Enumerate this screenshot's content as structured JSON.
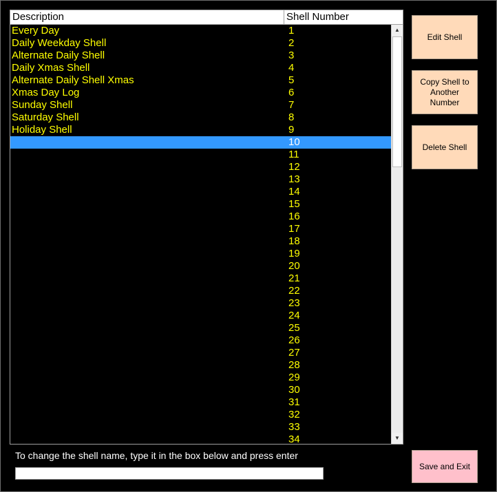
{
  "grid": {
    "columns": {
      "description": "Description",
      "shell_number": "Shell Number"
    },
    "selected_index": 9,
    "rows": [
      {
        "description": "Every Day",
        "number": "1"
      },
      {
        "description": "Daily Weekday Shell",
        "number": "2"
      },
      {
        "description": "Alternate Daily Shell",
        "number": "3"
      },
      {
        "description": "Daily  Xmas Shell",
        "number": "4"
      },
      {
        "description": "Alternate Daily Shell Xmas",
        "number": "5"
      },
      {
        "description": "Xmas Day Log",
        "number": "6"
      },
      {
        "description": "Sunday Shell",
        "number": "7"
      },
      {
        "description": "Saturday Shell",
        "number": "8"
      },
      {
        "description": "Holiday Shell",
        "number": "9"
      },
      {
        "description": "",
        "number": "10"
      },
      {
        "description": "",
        "number": "11"
      },
      {
        "description": "",
        "number": "12"
      },
      {
        "description": "",
        "number": "13"
      },
      {
        "description": "",
        "number": "14"
      },
      {
        "description": "",
        "number": "15"
      },
      {
        "description": "",
        "number": "16"
      },
      {
        "description": "",
        "number": "17"
      },
      {
        "description": "",
        "number": "18"
      },
      {
        "description": "",
        "number": "19"
      },
      {
        "description": "",
        "number": "20"
      },
      {
        "description": "",
        "number": "21"
      },
      {
        "description": "",
        "number": "22"
      },
      {
        "description": "",
        "number": "23"
      },
      {
        "description": "",
        "number": "24"
      },
      {
        "description": "",
        "number": "25"
      },
      {
        "description": "",
        "number": "26"
      },
      {
        "description": "",
        "number": "27"
      },
      {
        "description": "",
        "number": "28"
      },
      {
        "description": "",
        "number": "29"
      },
      {
        "description": "",
        "number": "30"
      },
      {
        "description": "",
        "number": "31"
      },
      {
        "description": "",
        "number": "32"
      },
      {
        "description": "",
        "number": "33"
      },
      {
        "description": "",
        "number": "34"
      }
    ]
  },
  "buttons": {
    "edit": "Edit Shell",
    "copy": "Copy Shell to Another Number",
    "delete": "Delete Shell",
    "save_exit": "Save and Exit"
  },
  "rename": {
    "hint": "To change the shell name, type it in the box below and press enter",
    "value": "",
    "placeholder": ""
  },
  "colors": {
    "background": "#000000",
    "row_text": "#ffff00",
    "selection": "#3399ff",
    "button": "#ffdab9",
    "save_button": "#ffc0cb"
  },
  "icons": {
    "scroll_up": "scroll-up-arrow-icon",
    "scroll_down": "scroll-down-arrow-icon"
  }
}
